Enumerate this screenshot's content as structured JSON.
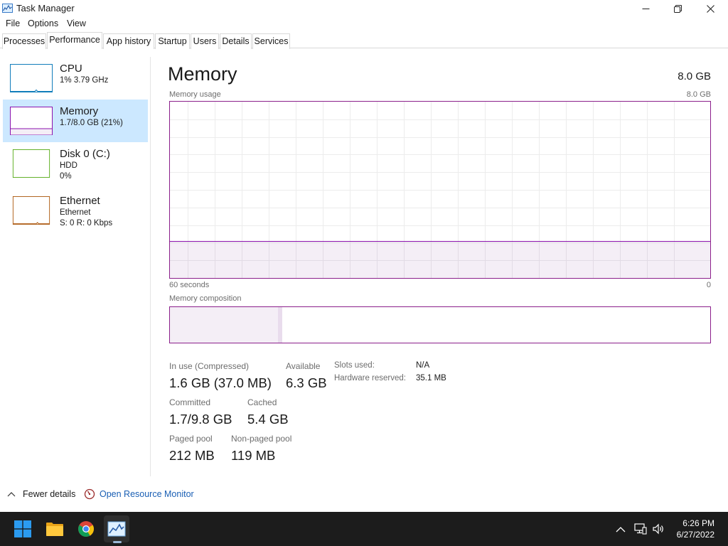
{
  "window": {
    "title": "Task Manager",
    "icon": "task-manager-icon"
  },
  "menu": [
    "File",
    "Options",
    "View"
  ],
  "tabs": [
    "Processes",
    "Performance",
    "App history",
    "Startup",
    "Users",
    "Details",
    "Services"
  ],
  "active_tab": "Performance",
  "sidebar": [
    {
      "title": "CPU",
      "line1": "1%  3.79 GHz",
      "line2": "",
      "color": "#117dbb",
      "selected": false
    },
    {
      "title": "Memory",
      "line1": "1.7/8.0 GB (21%)",
      "line2": "",
      "color": "#8b12ae",
      "selected": true
    },
    {
      "title": "Disk 0 (C:)",
      "line1": "HDD",
      "line2": "0%",
      "color": "#4da60c",
      "selected": false
    },
    {
      "title": "Ethernet",
      "line1": "Ethernet",
      "line2": "S: 0  R: 0 Kbps",
      "color": "#a74f01",
      "selected": false
    }
  ],
  "main": {
    "title": "Memory",
    "total": "8.0 GB",
    "usage_label": "Memory usage",
    "usage_max": "8.0 GB",
    "time_left": "60 seconds",
    "time_right": "0",
    "composition_label": "Memory composition",
    "usage_fraction": 0.21,
    "composition": {
      "in_use": 0.2,
      "modified": 0.008,
      "standby": 0.67,
      "free": 0.122
    }
  },
  "stats": {
    "in_use_label": "In use (Compressed)",
    "in_use_value": "1.6 GB (37.0 MB)",
    "available_label": "Available",
    "available_value": "6.3 GB",
    "committed_label": "Committed",
    "committed_value": "1.7/9.8 GB",
    "cached_label": "Cached",
    "cached_value": "5.4 GB",
    "paged_label": "Paged pool",
    "paged_value": "212 MB",
    "nonpaged_label": "Non-paged pool",
    "nonpaged_value": "119 MB",
    "slots_label": "Slots used:",
    "slots_value": "N/A",
    "hw_reserved_label": "Hardware reserved:",
    "hw_reserved_value": "35.1 MB"
  },
  "footer": {
    "fewer_details": "Fewer details",
    "open_resmon": "Open Resource Monitor"
  },
  "taskbar": {
    "time": "6:26 PM",
    "date": "6/27/2022"
  },
  "colors": {
    "memory": "#8b12ae",
    "selection": "#cce8ff",
    "link": "#1a5fb4"
  }
}
